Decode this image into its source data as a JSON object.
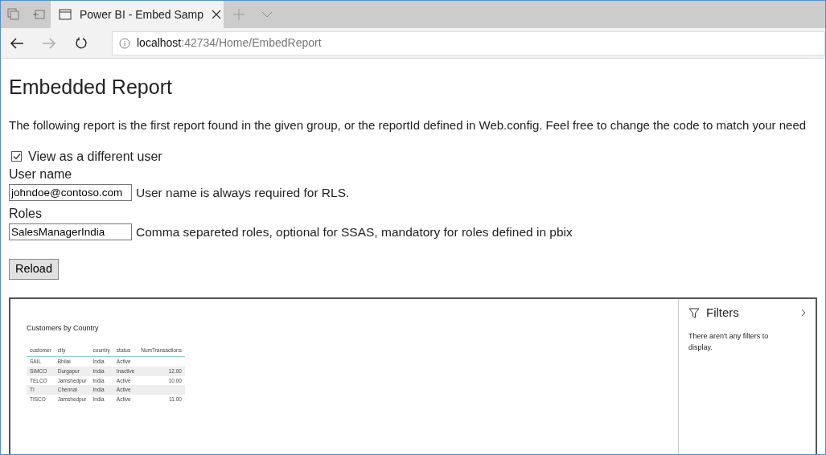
{
  "browser": {
    "tab_title": "Power BI - Embed Samp",
    "address_host": "localhost",
    "address_path": ":42734/Home/EmbedReport"
  },
  "page": {
    "heading": "Embedded Report",
    "intro": "The following report is the first report found in the given group, or the reportId defined in Web.config. Feel free to change the code to match your need",
    "view_as": {
      "label": "View as a different user",
      "checked": true
    },
    "username": {
      "label": "User name",
      "value": "johndoe@contoso.com",
      "hint": "User name is always required for RLS."
    },
    "roles": {
      "label": "Roles",
      "value": "SalesManagerIndia",
      "hint": "Comma separeted roles, optional for SSAS, mandatory for roles defined in pbix"
    },
    "reload_button": "Reload"
  },
  "report": {
    "visual_title": "Customers by Country",
    "columns": [
      "customer",
      "city",
      "country",
      "status",
      "NumTransactions"
    ],
    "rows": [
      [
        "SAIL",
        "Bhilai",
        "India",
        "Active",
        ""
      ],
      [
        "SIMCO",
        "Durgapur",
        "India",
        "Inactive",
        "12.00"
      ],
      [
        "TELCO",
        "Jamshedpur",
        "India",
        "Active",
        "10.00"
      ],
      [
        "TI",
        "Chennai",
        "India",
        "Active",
        ""
      ],
      [
        "TISCO",
        "Jamshedpur",
        "India",
        "Active",
        "11.00"
      ]
    ],
    "filters": {
      "title": "Filters",
      "empty_message": "There aren't any filters to display."
    }
  }
}
